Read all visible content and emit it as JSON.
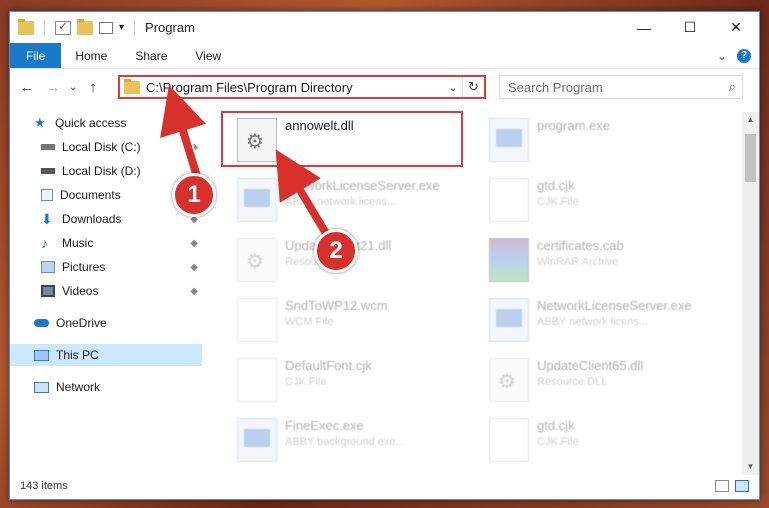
{
  "window": {
    "title": "Program",
    "controls": {
      "minimize": "—",
      "maximize": "☐",
      "close": "✕"
    }
  },
  "ribbon": {
    "tabs": [
      {
        "label": "File"
      },
      {
        "label": "Home"
      },
      {
        "label": "Share"
      },
      {
        "label": "View"
      }
    ],
    "expand": "⌄",
    "help": "?"
  },
  "nav": {
    "back": "←",
    "forward": "→",
    "recent": "⌄",
    "up": "↑"
  },
  "address": {
    "path": "C:\\Program Files\\Program Directory",
    "dropdown": "⌄",
    "refresh": "↻"
  },
  "search": {
    "placeholder": "Search Program",
    "icon": "⌕"
  },
  "sidebar": {
    "items": [
      {
        "label": "Quick access",
        "icon": "star-icon",
        "pinned": false
      },
      {
        "label": "Local Disk (C:)",
        "icon": "drive-icon",
        "pinned": true
      },
      {
        "label": "Local Disk (D:)",
        "icon": "drive-icon",
        "pinned": true
      },
      {
        "label": "Documents",
        "icon": "documents-icon",
        "pinned": true
      },
      {
        "label": "Downloads",
        "icon": "download-icon",
        "pinned": true
      },
      {
        "label": "Music",
        "icon": "music-icon",
        "pinned": true
      },
      {
        "label": "Pictures",
        "icon": "pictures-icon",
        "pinned": true
      },
      {
        "label": "Videos",
        "icon": "videos-icon",
        "pinned": true
      },
      {
        "label": "OneDrive",
        "icon": "cloud-icon",
        "pinned": false
      },
      {
        "label": "This PC",
        "icon": "computer-icon",
        "pinned": false,
        "active": true
      },
      {
        "label": "Network",
        "icon": "network-icon",
        "pinned": false
      }
    ],
    "pin_glyph": "📌"
  },
  "files": [
    {
      "name": "annowelt.dll",
      "type": "",
      "icon": "dll-icon",
      "highlighted": true
    },
    {
      "name": "program.exe",
      "type": "",
      "icon": "exe-icon"
    },
    {
      "name": "NetworkLicenseServer.exe",
      "type": "ABBY network licens...",
      "icon": "exe-icon"
    },
    {
      "name": "gtd.cjk",
      "type": "CJK File",
      "icon": "doc-icon"
    },
    {
      "name": "UpdateClient21.dll",
      "type": "Resource DLL",
      "icon": "dll-icon"
    },
    {
      "name": "certificates.cab",
      "type": "WinRAR Archive",
      "icon": "cab-icon"
    },
    {
      "name": "SndToWP12.wcm",
      "type": "WCM File",
      "icon": "doc-icon"
    },
    {
      "name": "NetworkLicenseServer.exe",
      "type": "ABBY network licens...",
      "icon": "exe-icon"
    },
    {
      "name": "DefaultFont.cjk",
      "type": "CJK File",
      "icon": "doc-icon"
    },
    {
      "name": "UpdateClient65.dll",
      "type": "Resource DLL",
      "icon": "dll-icon"
    },
    {
      "name": "FineExec.exe",
      "type": "ABBY background exe...",
      "icon": "exe-icon"
    },
    {
      "name": "gtd.cjk",
      "type": "CJK File",
      "icon": "doc-icon"
    }
  ],
  "status": {
    "count": "143 items"
  },
  "callouts": [
    {
      "label": "1"
    },
    {
      "label": "2"
    }
  ],
  "colors": {
    "accent": "#1979ca",
    "highlight": "#e23a3a",
    "badge": "#d8312b"
  }
}
